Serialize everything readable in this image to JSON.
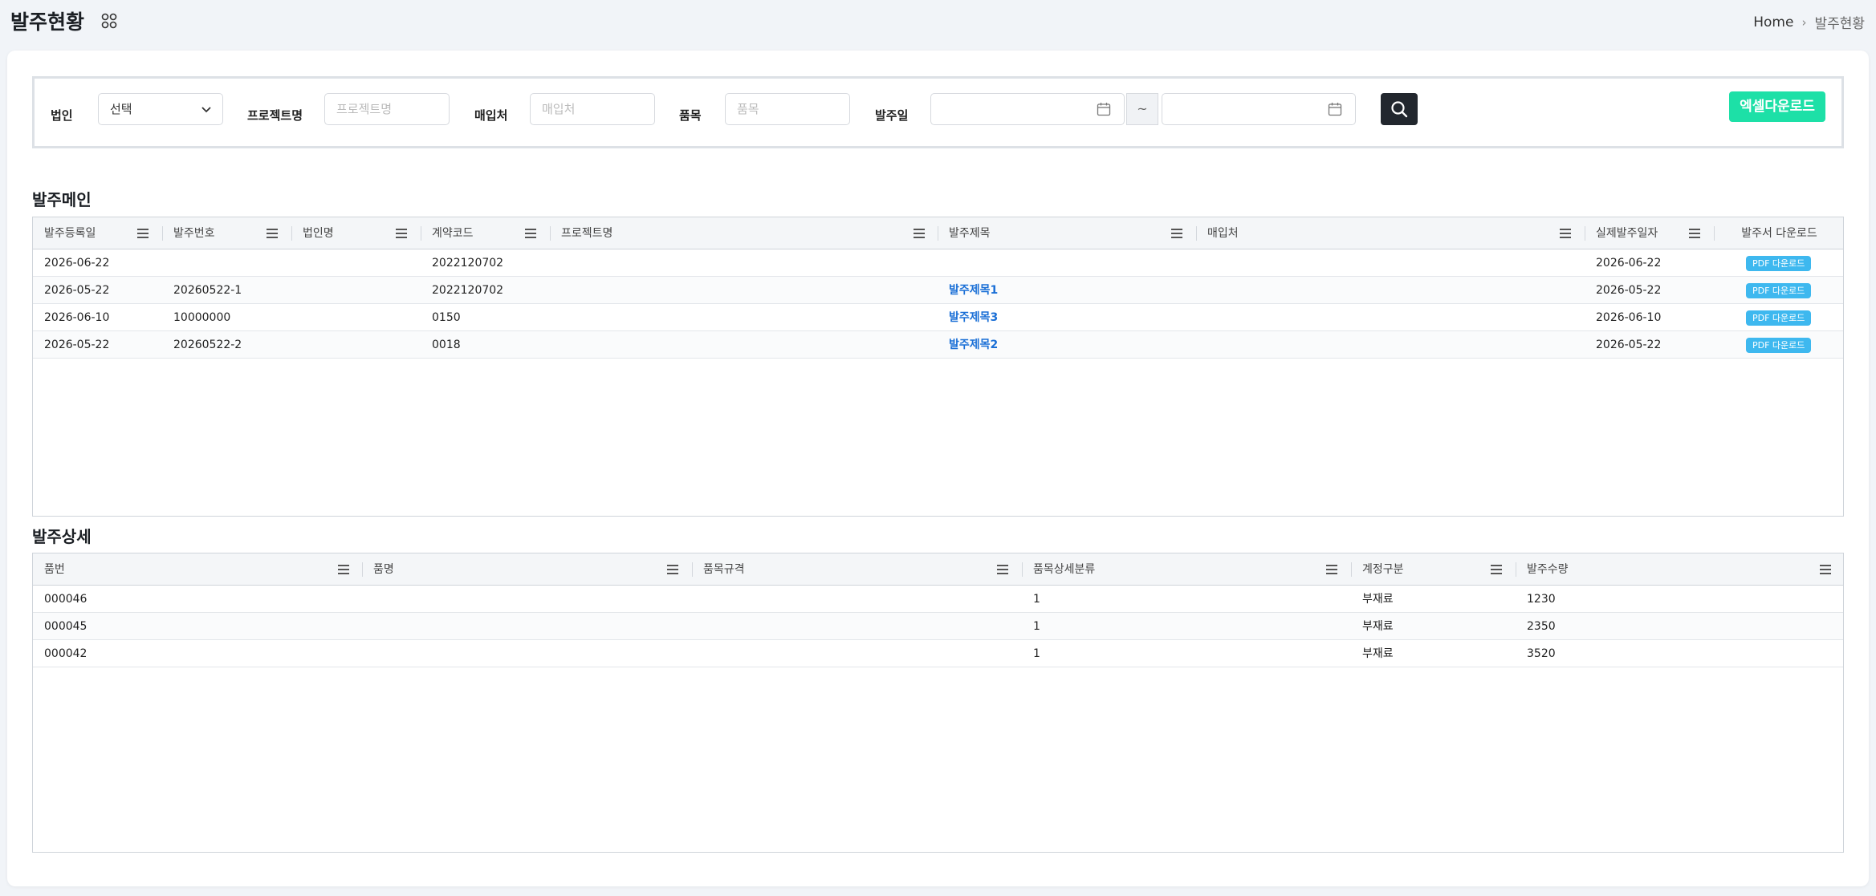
{
  "page": {
    "title": "발주현황",
    "breadcrumb": {
      "home": "Home",
      "current": "발주현황"
    }
  },
  "filters": {
    "corp_label": "법인",
    "corp_value": "선택",
    "project_label": "프로젝트명",
    "project_placeholder": "프로젝트명",
    "vendor_label": "매입처",
    "vendor_placeholder": "매입처",
    "item_label": "품목",
    "item_placeholder": "품목",
    "date_label": "발주일",
    "date_sep": "~",
    "excel_label": "엑셀다운로드"
  },
  "main_grid": {
    "title": "발주메인",
    "columns": [
      "발주등록일",
      "발주번호",
      "법인명",
      "계약코드",
      "프로젝트명",
      "발주제목",
      "매입처",
      "실제발주일자",
      "발주서 다운로드"
    ],
    "rows": [
      {
        "reg_date": "2026-06-22",
        "po_no": "",
        "corp": "",
        "contract": "2022120702",
        "project": "",
        "subject": "",
        "vendor": "",
        "actual_date": "2026-06-22",
        "download": "PDF 다운로드"
      },
      {
        "reg_date": "2026-05-22",
        "po_no": "20260522-1",
        "corp": "",
        "contract": "2022120702",
        "project": "",
        "subject": "발주제목1",
        "vendor": "",
        "actual_date": "2026-05-22",
        "download": "PDF 다운로드"
      },
      {
        "reg_date": "2026-06-10",
        "po_no": "10000000",
        "corp": "",
        "contract": "0150",
        "project": "",
        "subject": "발주제목3",
        "vendor": "",
        "actual_date": "2026-06-10",
        "download": "PDF 다운로드"
      },
      {
        "reg_date": "2026-05-22",
        "po_no": "20260522-2",
        "corp": "",
        "contract": "0018",
        "project": "",
        "subject": "발주제목2",
        "vendor": "",
        "actual_date": "2026-05-22",
        "download": "PDF 다운로드"
      }
    ]
  },
  "detail_grid": {
    "title": "발주상세",
    "columns": [
      "품번",
      "품명",
      "품목규격",
      "품목상세분류",
      "계정구분",
      "발주수량"
    ],
    "rows": [
      {
        "part_no": "000046",
        "name": "",
        "spec": "",
        "detail_class": "1",
        "account": "부재료",
        "qty": "1230"
      },
      {
        "part_no": "000045",
        "name": "",
        "spec": "",
        "detail_class": "1",
        "account": "부재료",
        "qty": "2350"
      },
      {
        "part_no": "000042",
        "name": "",
        "spec": "",
        "detail_class": "1",
        "account": "부재료",
        "qty": "3520"
      }
    ]
  },
  "colors": {
    "accent_green": "#1de0a7",
    "pdf_blue": "#3eb8ef",
    "link_blue": "#1a6fd6",
    "dark_button": "#22272e"
  }
}
